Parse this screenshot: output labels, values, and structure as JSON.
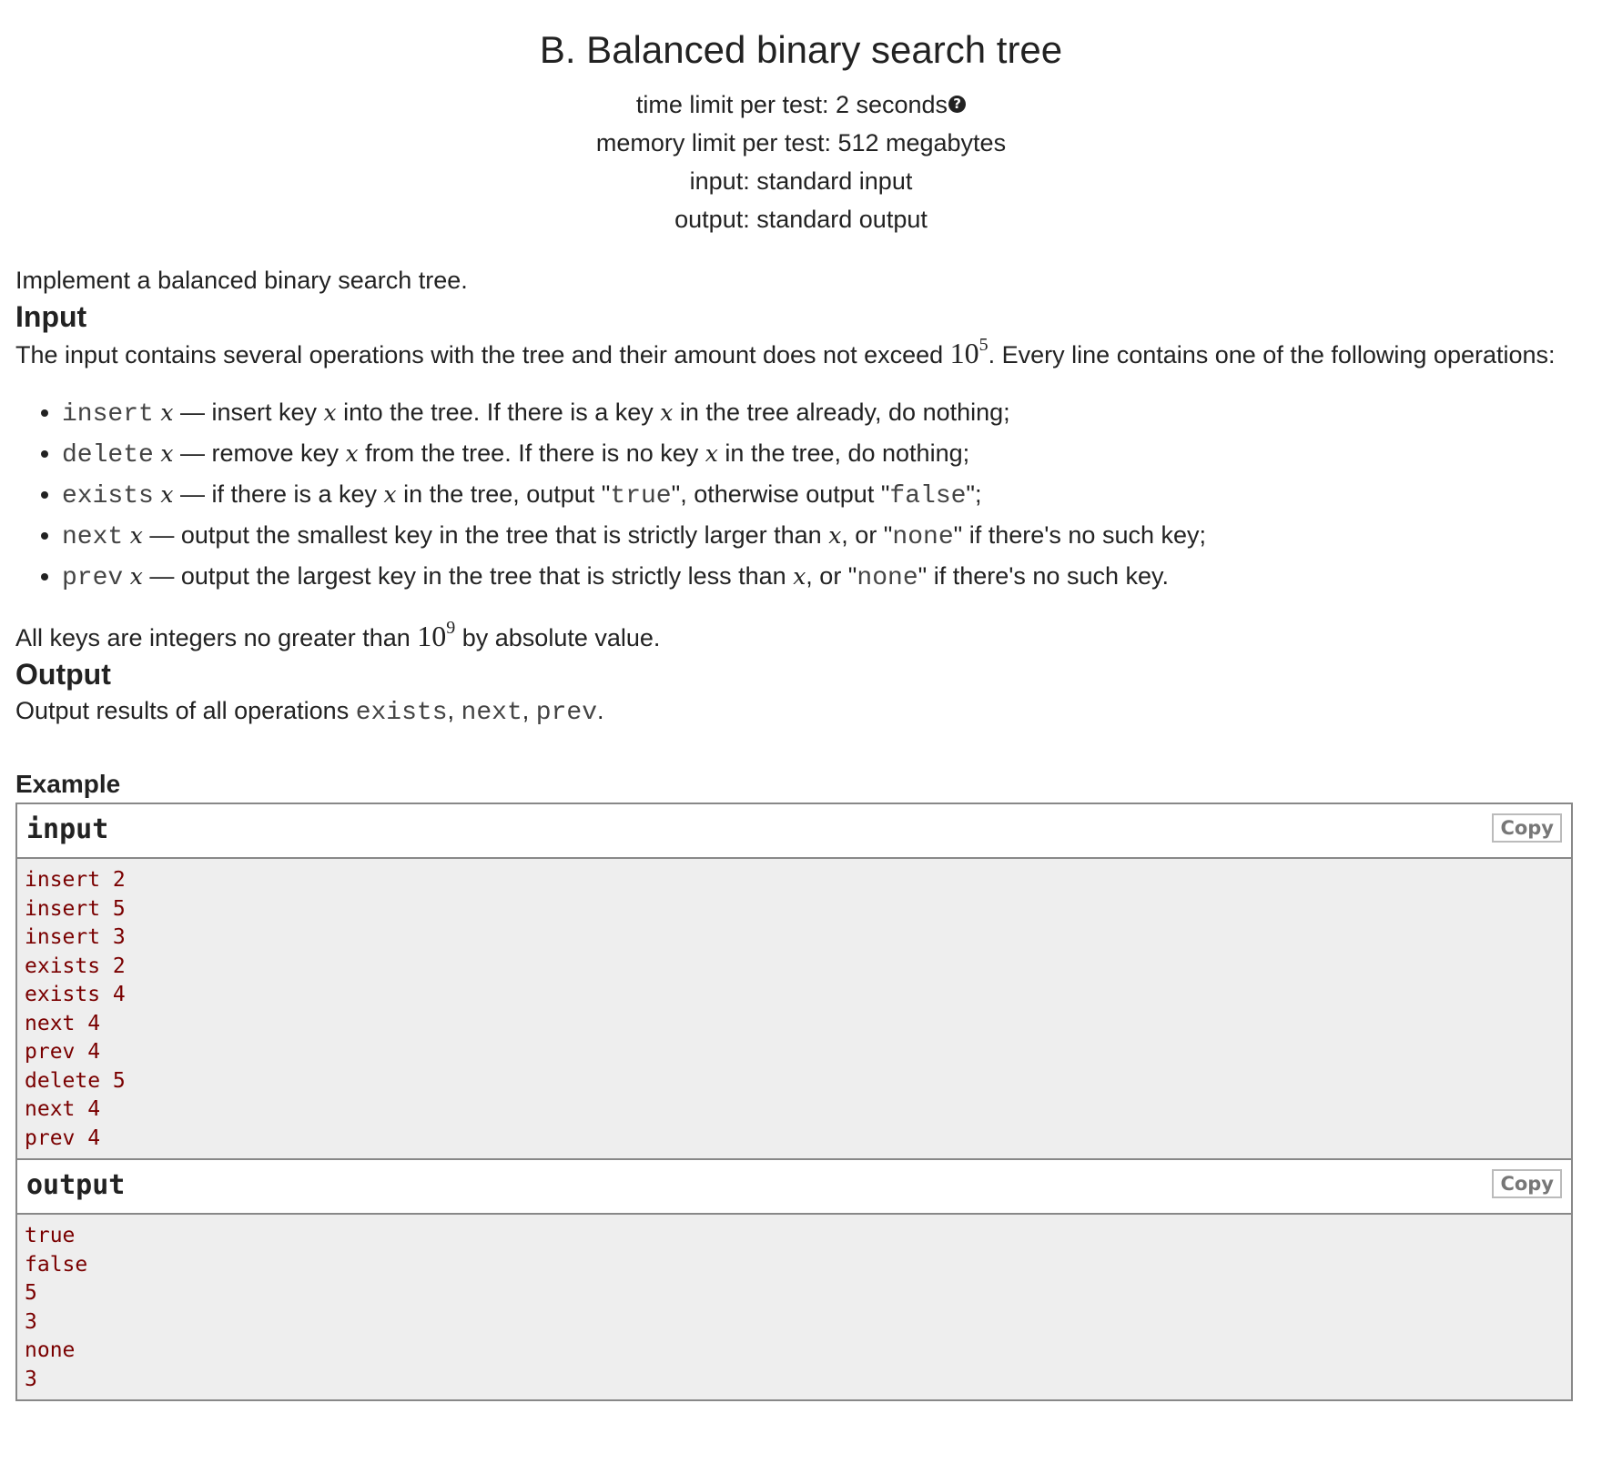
{
  "header": {
    "title": "B. Balanced binary search tree",
    "time_limit": "time limit per test: 2 seconds",
    "memory_limit": "memory limit per test: 512 megabytes",
    "input": "input: standard input",
    "output": "output: standard output"
  },
  "legend": "Implement a balanced binary search tree.",
  "input_section": {
    "title": "Input",
    "intro_before": "The input contains several operations with the tree and their amount does not exceed ",
    "intro_base": "10",
    "intro_exp": "5",
    "intro_after": ". Every line contains one of the following operations:",
    "ops": [
      {
        "cmd": "insert",
        "var": "x",
        "parts": [
          " — insert key ",
          "x",
          " into the tree. If there is a key ",
          "x",
          " in the tree already, do nothing;"
        ]
      },
      {
        "cmd": "delete",
        "var": "x",
        "parts": [
          " — remove key ",
          "x",
          " from the tree. If there is no key ",
          "x",
          " in the tree, do nothing;"
        ]
      },
      {
        "cmd": "exists",
        "var": "x",
        "parts": [
          " — if there is a key ",
          "x",
          " in the tree, output \"",
          "true",
          "\", otherwise output \"",
          "false",
          "\";"
        ]
      },
      {
        "cmd": "next",
        "var": "x",
        "parts": [
          " — output the smallest key in the tree that is strictly larger than ",
          "x",
          ", or \"",
          "none",
          "\" if there's no such key;"
        ]
      },
      {
        "cmd": "prev",
        "var": "x",
        "parts": [
          " — output the largest key in the tree that is strictly less than ",
          "x",
          ", or \"",
          "none",
          "\" if there's no such key."
        ]
      }
    ],
    "keys_before": "All keys are integers no greater than ",
    "keys_base": "10",
    "keys_exp": "9",
    "keys_after": " by absolute value."
  },
  "output_section": {
    "title": "Output",
    "text_before": "Output results of all operations ",
    "cmd1": "exists",
    "sep1": ", ",
    "cmd2": "next",
    "sep2": ", ",
    "cmd3": "prev",
    "text_after": "."
  },
  "example": {
    "title": "Example",
    "input_label": "input",
    "output_label": "output",
    "copy_label": "Copy",
    "input_lines": [
      "insert 2",
      "insert 5",
      "insert 3",
      "exists 2",
      "exists 4",
      "next 4",
      "prev 4",
      "delete 5",
      "next 4",
      "prev 4"
    ],
    "output_lines": [
      "true",
      "false",
      "5",
      "3",
      "none",
      "3"
    ]
  }
}
